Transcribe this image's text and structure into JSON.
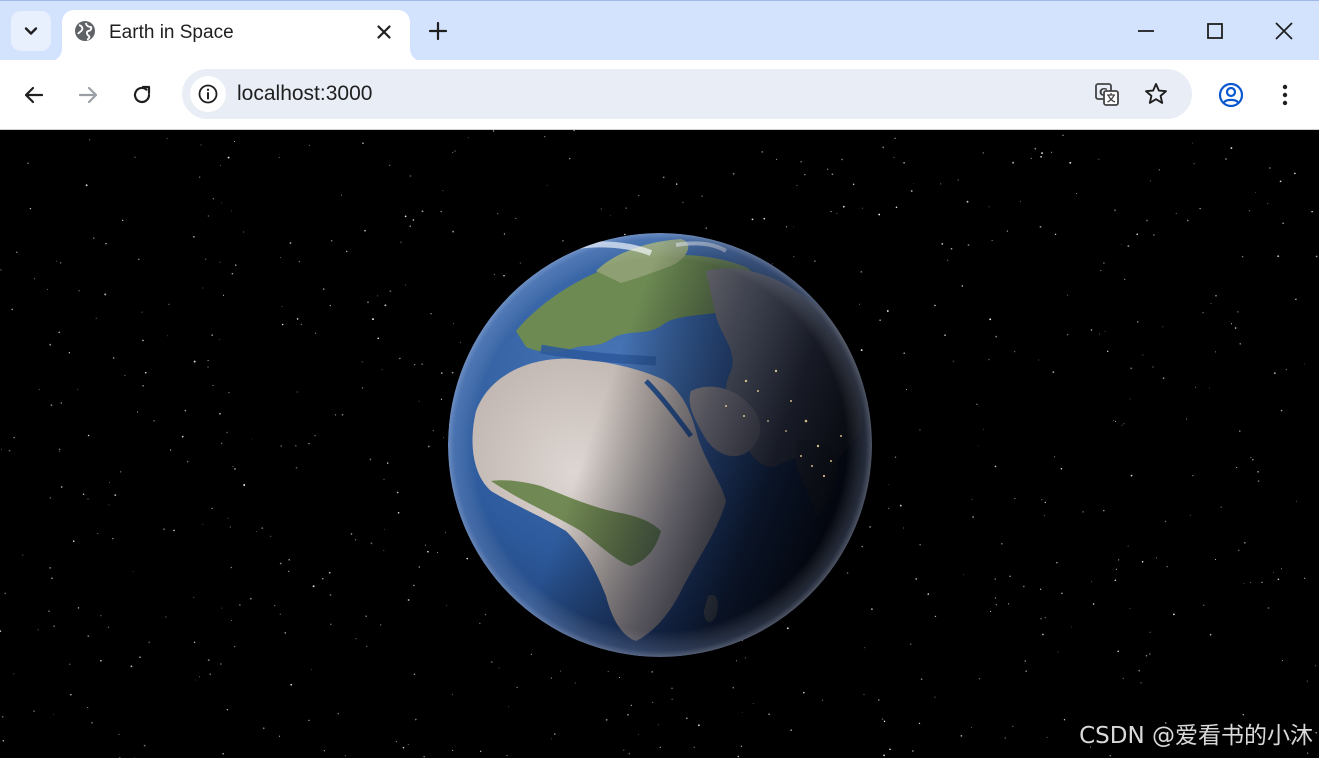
{
  "browser": {
    "tab": {
      "title": "Earth in Space",
      "favicon": "globe-icon",
      "close_icon": "close-icon"
    },
    "tab_search_icon": "chevron-down-icon",
    "new_tab_icon": "plus-icon",
    "window_controls": [
      "minimize-icon",
      "maximize-icon",
      "close-icon"
    ],
    "nav": {
      "back_icon": "arrow-left-icon",
      "forward_icon": "arrow-right-icon",
      "reload_icon": "reload-icon",
      "forward_enabled": false
    },
    "omnibox": {
      "url": "localhost:3000",
      "site_info_icon": "info-icon",
      "translate_icon": "translate-icon",
      "bookmark_icon": "star-icon"
    },
    "profile_icon": "account-circle-icon",
    "menu_icon": "kebab-menu-icon"
  },
  "page": {
    "scene": "earth-globe-starfield",
    "watermark": "CSDN @爱看书的小沐"
  },
  "colors": {
    "tabstrip": "#d3e3fd",
    "omnibox": "#e9eef6",
    "accent": "#0b57d0",
    "space": "#000000",
    "ocean": "#2d5a9c",
    "land_desert": "#cfc8c2",
    "land_green": "#5f7d3f"
  }
}
